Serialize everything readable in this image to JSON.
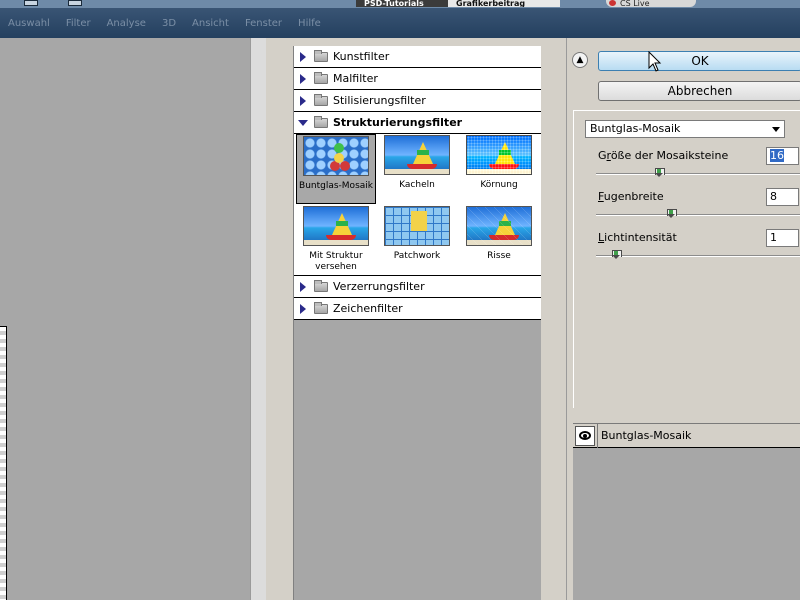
{
  "topbar": {
    "tabs": [
      "PSD-Tutorials",
      "Grafikerbeitrag"
    ],
    "cslive": "CS Live",
    "menu": [
      "Auswahl",
      "Filter",
      "Analyse",
      "3D",
      "Ansicht",
      "Fenster",
      "Hilfe"
    ]
  },
  "gallery": {
    "categories_top": [
      {
        "label": "Kunstfilter"
      },
      {
        "label": "Malfilter"
      },
      {
        "label": "Stilisierungsfilter"
      }
    ],
    "open_category": {
      "label": "Strukturierungsfilter"
    },
    "thumbnails": [
      {
        "label": "Buntglas-Mosaik",
        "selected": true
      },
      {
        "label": "Kacheln",
        "selected": false
      },
      {
        "label": "Körnung",
        "selected": false
      },
      {
        "label": "Mit Struktur versehen",
        "selected": false
      },
      {
        "label": "Patchwork",
        "selected": false
      },
      {
        "label": "Risse",
        "selected": false
      }
    ],
    "categories_bottom": [
      {
        "label": "Verzerrungsfilter"
      },
      {
        "label": "Zeichenfilter"
      }
    ]
  },
  "actions": {
    "ok_label": "OK",
    "cancel_label": "Abbrechen"
  },
  "settings": {
    "filter_select": "Buntglas-Mosaik",
    "params": [
      {
        "pre": "G",
        "ul": "r",
        "post": "öße der Mosaiksteine",
        "value": "16",
        "fraction": 0.31
      },
      {
        "pre": "",
        "ul": "F",
        "post": "ugenbreite",
        "value": "8",
        "fraction": 0.37
      },
      {
        "pre": "",
        "ul": "L",
        "post": "ichtintensität",
        "value": "1",
        "fraction": 0.1
      }
    ]
  },
  "layers": {
    "items": [
      {
        "name": "Buntglas-Mosaik",
        "visible": true
      }
    ]
  },
  "colors": {
    "accent": "#316ac5",
    "ok_button": "#b8dcf2"
  }
}
